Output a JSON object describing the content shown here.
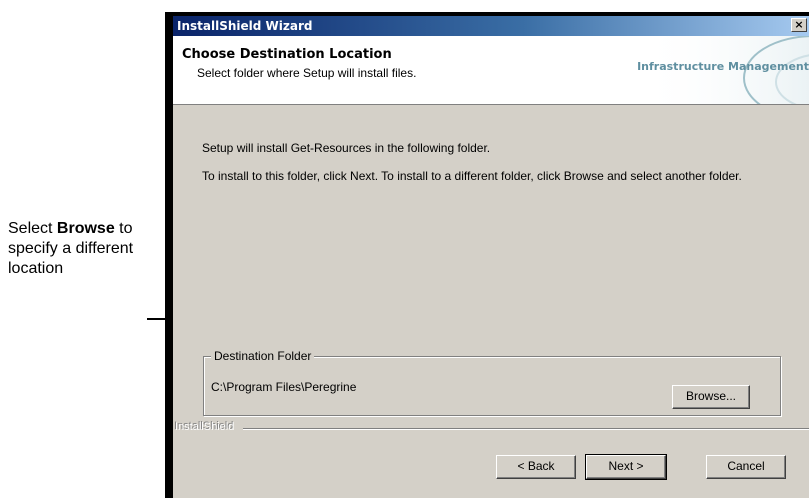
{
  "annotation": {
    "prefix": "Select ",
    "bold": "Browse",
    "suffix": " to specify a different location"
  },
  "window": {
    "title": "InstallShield Wizard",
    "close_glyph": "×"
  },
  "header": {
    "title": "Choose Destination Location",
    "subtitle": "Select folder where Setup will install files.",
    "brand": "Infrastructure Management"
  },
  "body": {
    "line1": "Setup will install Get-Resources in the following folder.",
    "line2": "To install to this folder, click Next. To install to a different folder, click Browse and select another folder."
  },
  "destination": {
    "legend": "Destination Folder",
    "path": "C:\\Program Files\\Peregrine",
    "browse_label": "Browse..."
  },
  "footer": {
    "installshield_label": "InstallShield",
    "back_label": "< Back",
    "next_label": "Next >",
    "cancel_label": "Cancel"
  },
  "colors": {
    "titlebar_start": "#0a246a",
    "titlebar_end": "#a6caf0",
    "dialog_face": "#d4d0c8",
    "brand_text": "#5f8fa0"
  }
}
